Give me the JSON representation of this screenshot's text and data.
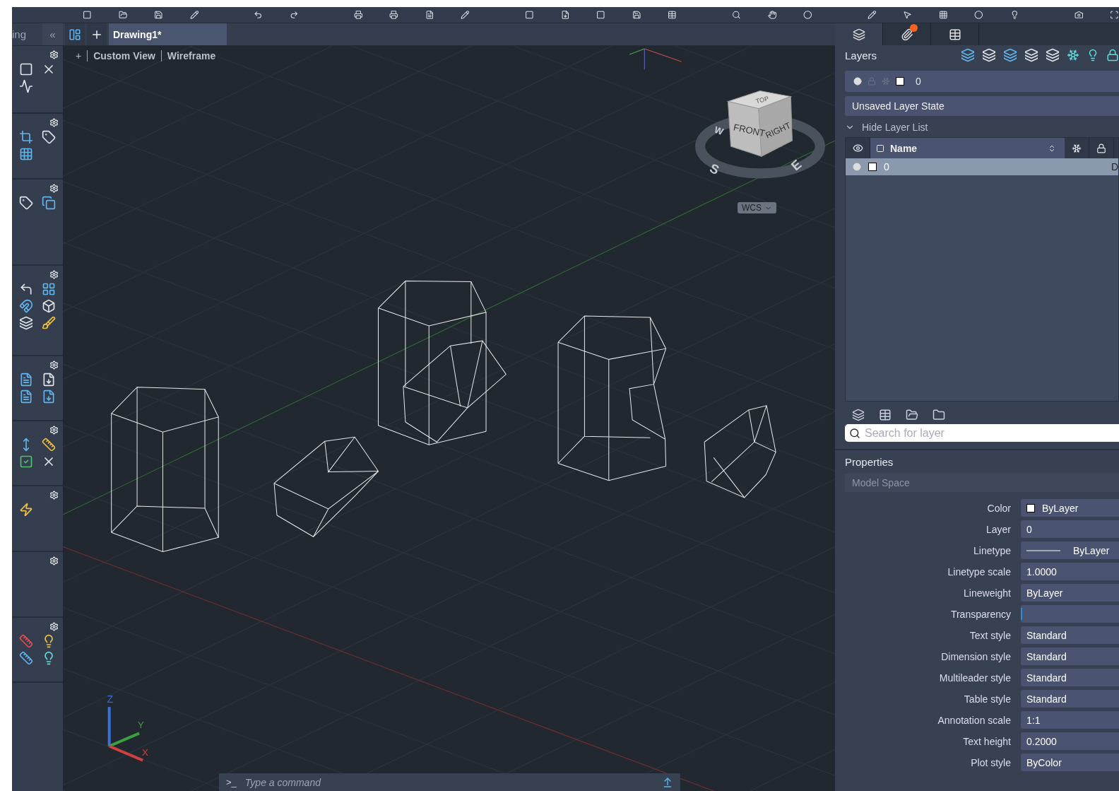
{
  "sidebar_tab": {
    "label": "ing"
  },
  "collapse_button": {
    "label": "«"
  },
  "file_tabs": [
    {
      "label": "Drawing1*",
      "selected": true
    }
  ],
  "viewport": {
    "controls": [
      "+",
      "Custom View",
      "Wireframe"
    ],
    "viewcube": {
      "faces": [
        "TOP",
        "FRONT",
        "RIGHT"
      ],
      "compass": [
        "W",
        "S",
        "E"
      ]
    },
    "ucs_menu": "WCS",
    "axis_labels": [
      "Z",
      "Y",
      "X"
    ]
  },
  "command_line": {
    "prompt": ">_",
    "placeholder": "Type a command"
  },
  "panel_tabs": [
    {
      "kind": "layers",
      "selected": true,
      "notification": false
    },
    {
      "kind": "attach",
      "selected": false,
      "notification": true
    },
    {
      "kind": "table",
      "selected": false,
      "notification": false
    }
  ],
  "layers": {
    "title": "Layers",
    "current_layer": "0",
    "layer_state": "Unsaved Layer State",
    "list_toggle": "Hide Layer List",
    "expanded": true,
    "column": "Name",
    "rows": [
      {
        "name": "0",
        "selected": true,
        "column_3": "D"
      }
    ],
    "search": {
      "placeholder": "Search for layer"
    }
  },
  "properties": {
    "title": "Properties",
    "scope": "Model Space",
    "rows": [
      {
        "label": "Color",
        "value": "ByLayer",
        "kind": "color"
      },
      {
        "label": "Layer",
        "value": "0",
        "kind": "text"
      },
      {
        "label": "Linetype",
        "value": "ByLayer",
        "kind": "linetype"
      },
      {
        "label": "Linetype scale",
        "value": "1.0000",
        "kind": "text"
      },
      {
        "label": "Lineweight",
        "value": "ByLayer",
        "kind": "text"
      },
      {
        "label": "Transparency",
        "kind": "slider",
        "level": 0
      },
      {
        "label": "Text style",
        "value": "Standard",
        "kind": "text"
      },
      {
        "label": "Dimension style",
        "value": "Standard",
        "kind": "text"
      },
      {
        "label": "Multileader style",
        "value": "Standard",
        "kind": "text"
      },
      {
        "label": "Table style",
        "value": "Standard",
        "kind": "text"
      },
      {
        "label": "Annotation scale",
        "value": "1:1",
        "kind": "text"
      },
      {
        "label": "Text height",
        "value": "0.2000",
        "kind": "text"
      },
      {
        "label": "Plot style",
        "value": "ByColor",
        "kind": "text"
      }
    ]
  }
}
